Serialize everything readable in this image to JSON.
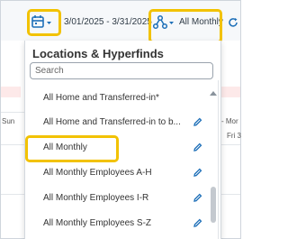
{
  "toolbar": {
    "date_range": "3/01/2025 - 3/31/2025",
    "location_selected": "All Monthly"
  },
  "background": {
    "left_day": "Sun",
    "right_day": "- Mor",
    "right_date": "Fri 3"
  },
  "dropdown": {
    "title": "Locations & Hyperfinds",
    "search_placeholder": "Search",
    "items": [
      {
        "label": "All Home and Transferred-in*"
      },
      {
        "label": "All Home and Transferred-in to b..."
      },
      {
        "label": "All Monthly"
      },
      {
        "label": "All Monthly Employees A-H"
      },
      {
        "label": "All Monthly Employees I-R"
      },
      {
        "label": "All Monthly Employees S-Z"
      }
    ]
  },
  "colors": {
    "highlight": "#f2c200",
    "accent": "#1d6fb8"
  },
  "icons": {
    "calendar": "calendar-icon",
    "location": "location-hierarchy-icon",
    "edit": "pencil-icon",
    "refresh": "refresh-icon",
    "caret": "caret-down-icon"
  }
}
